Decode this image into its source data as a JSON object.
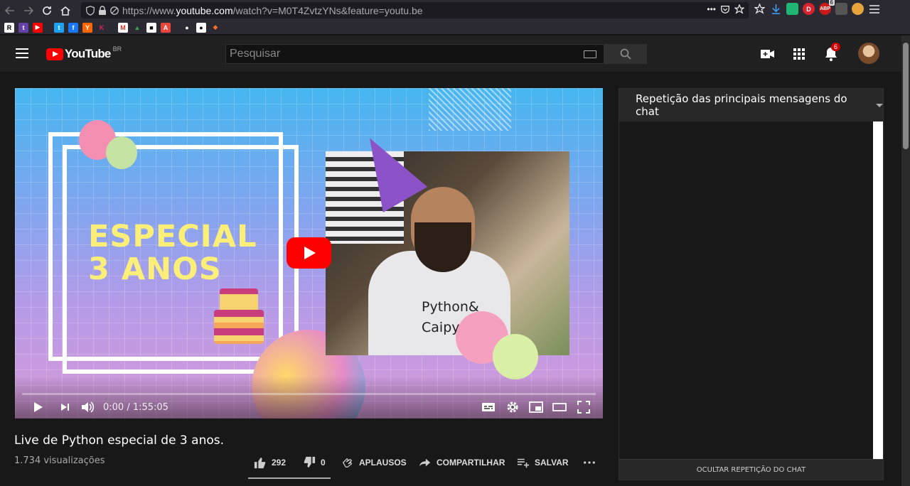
{
  "browser": {
    "url_prefix": "https://www.",
    "url_host": "youtube.com",
    "url_path": "/watch?v=M0T4ZvtzYNs&feature=youtu.be",
    "url_menu_glyph": "•••",
    "ext_badge_count": "6",
    "ext_abp_label": "ABP",
    "ext_d_label": "D"
  },
  "bookmarks": [
    {
      "icon": "r-icon",
      "glyph": "R",
      "bg": "#ffffff",
      "fg": "#000000"
    },
    {
      "icon": "twitch-icon",
      "glyph": "t",
      "bg": "#6441a5",
      "fg": "#ffffff"
    },
    {
      "icon": "youtube-icon",
      "glyph": "▶",
      "bg": "#ff0000",
      "fg": "#ffffff"
    },
    {
      "icon": "twitter-icon",
      "glyph": "t",
      "bg": "#1da1f2",
      "fg": "#ffffff"
    },
    {
      "icon": "facebook-icon",
      "glyph": "f",
      "bg": "#1877f2",
      "fg": "#ffffff"
    },
    {
      "icon": "hackernews-icon",
      "glyph": "Y",
      "bg": "#ff6600",
      "fg": "#ffffff"
    },
    {
      "icon": "k-icon",
      "glyph": "K",
      "bg": "#2b2a33",
      "fg": "#e0245e"
    },
    {
      "icon": "gmail-icon",
      "glyph": "M",
      "bg": "#ffffff",
      "fg": "#d93025"
    },
    {
      "icon": "drive-icon",
      "glyph": "▲",
      "bg": "#2b2a33",
      "fg": "#34a853"
    },
    {
      "icon": "square-icon",
      "glyph": "■",
      "bg": "#ffffff",
      "fg": "#000000"
    },
    {
      "icon": "a-icon",
      "glyph": "A",
      "bg": "#e8453c",
      "fg": "#ffffff"
    },
    {
      "icon": "github-icon",
      "glyph": "●",
      "bg": "#2b2a33",
      "fg": "#ffffff"
    },
    {
      "icon": "github-alt-icon",
      "glyph": "●",
      "bg": "#ffffff",
      "fg": "#000000"
    },
    {
      "icon": "gitlab-icon",
      "glyph": "◆",
      "bg": "#2b2a33",
      "fg": "#fc6d26"
    }
  ],
  "masthead": {
    "logo_text": "YouTube",
    "country": "BR",
    "search_placeholder": "Pesquisar",
    "notifications_count": "6"
  },
  "player": {
    "thumbnail_title_line1": "ESPECIAL",
    "thumbnail_title_line2": "3 ANOS",
    "shirt_text_line1": "Python&",
    "shirt_text_line2": "Caipy",
    "time_display": "0:00 / 1:55:05",
    "progress_fraction": 0
  },
  "video": {
    "title": "Live de Python especial de 3 anos.",
    "views": "1.734 visualizações",
    "likes": "292",
    "dislikes": "0",
    "applause_label": "APLAUSOS",
    "share_label": "COMPARTILHAR",
    "save_label": "SALVAR"
  },
  "chat": {
    "header": "Repetição das principais mensagens do chat",
    "footer": "OCULTAR REPETIÇÃO DO CHAT"
  }
}
